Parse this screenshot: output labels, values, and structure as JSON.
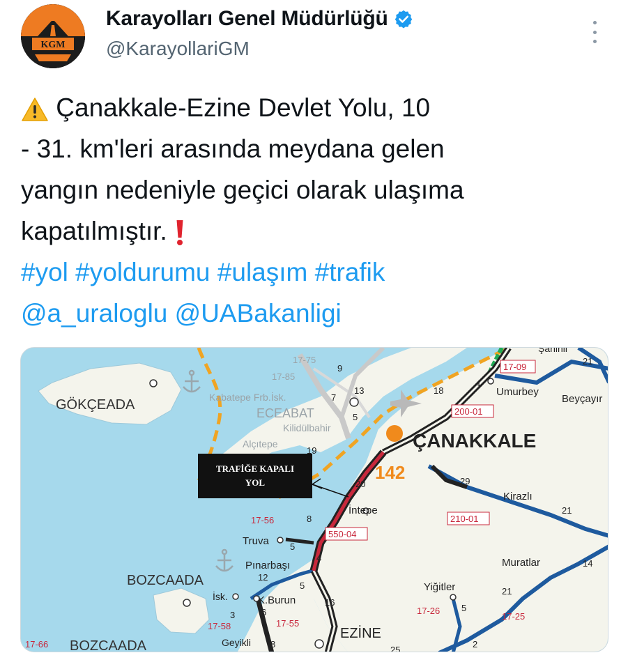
{
  "account": {
    "display_name": "Karayolları Genel Müdürlüğü",
    "handle": "@KarayollariGM",
    "avatar_text": "KGM",
    "verified": true
  },
  "tweet": {
    "warning_icon": "warning-sign-icon",
    "line1": "Çanakkale-Ezine Devlet Yolu, 10",
    "line2": "- 31. km'leri arasında meydana gelen",
    "line3": "yangın nedeniyle geçici olarak ulaşıma",
    "line4": "kapatılmıştır.",
    "exclamation_icon": "red-exclamation-icon",
    "hashtags": [
      "#yol",
      "#yoldurumu",
      "#ulaşım",
      "#trafik"
    ],
    "mentions": [
      "@a_uraloglu",
      "@UABakanligi"
    ]
  },
  "map": {
    "callout": "TRAFİĞE KAPALI YOL",
    "callout_line1": "TRAFİĞE KAPALI",
    "callout_line2": "YOL",
    "places": {
      "gokceada": "GÖKÇEADA",
      "eceabat": "ECEABAT",
      "kilitbahir": "Kilidülbahir",
      "alcitepe": "Alçıtepe",
      "kabatepe": "Kabatepe Frb.İsk.",
      "canakkale": "ÇANAKKALE",
      "umurbey": "Umurbey",
      "beycayir": "Beyçayır",
      "sahinli": "Şahinli",
      "kirazli": "Kirazlı",
      "intepe": "İntepe",
      "truva": "Truva",
      "pinarbasi": "Pınarbaşı",
      "bozcaada_island": "BOZCAADA",
      "bozcaada_town": "BOZCAADA",
      "isk": "İsk.",
      "kburun": "K.Burun",
      "geyikli": "Geyikli",
      "ezine": "EZİNE",
      "muratlar": "Muratlar",
      "yigitler": "Yiğitler"
    },
    "route_labels": {
      "r1775": "17-75",
      "r1785": "17-85",
      "r1709": "17-09",
      "r20001": "200-01",
      "r21001": "210-01",
      "r1756": "17-56",
      "r55004": "550-04",
      "r1726": "17-26",
      "r1725": "17-25",
      "r1758": "17-58",
      "r1755": "17-55",
      "r1766": "17-66",
      "road142": "142"
    },
    "km_markers": [
      "9",
      "7",
      "5",
      "13",
      "19",
      "18",
      "4",
      "21",
      "29",
      "21",
      "20",
      "8",
      "5",
      "4",
      "12",
      "5",
      "16",
      "6",
      "3",
      "8",
      "5",
      "2",
      "21",
      "14",
      "25",
      "1",
      "1",
      "2"
    ]
  }
}
